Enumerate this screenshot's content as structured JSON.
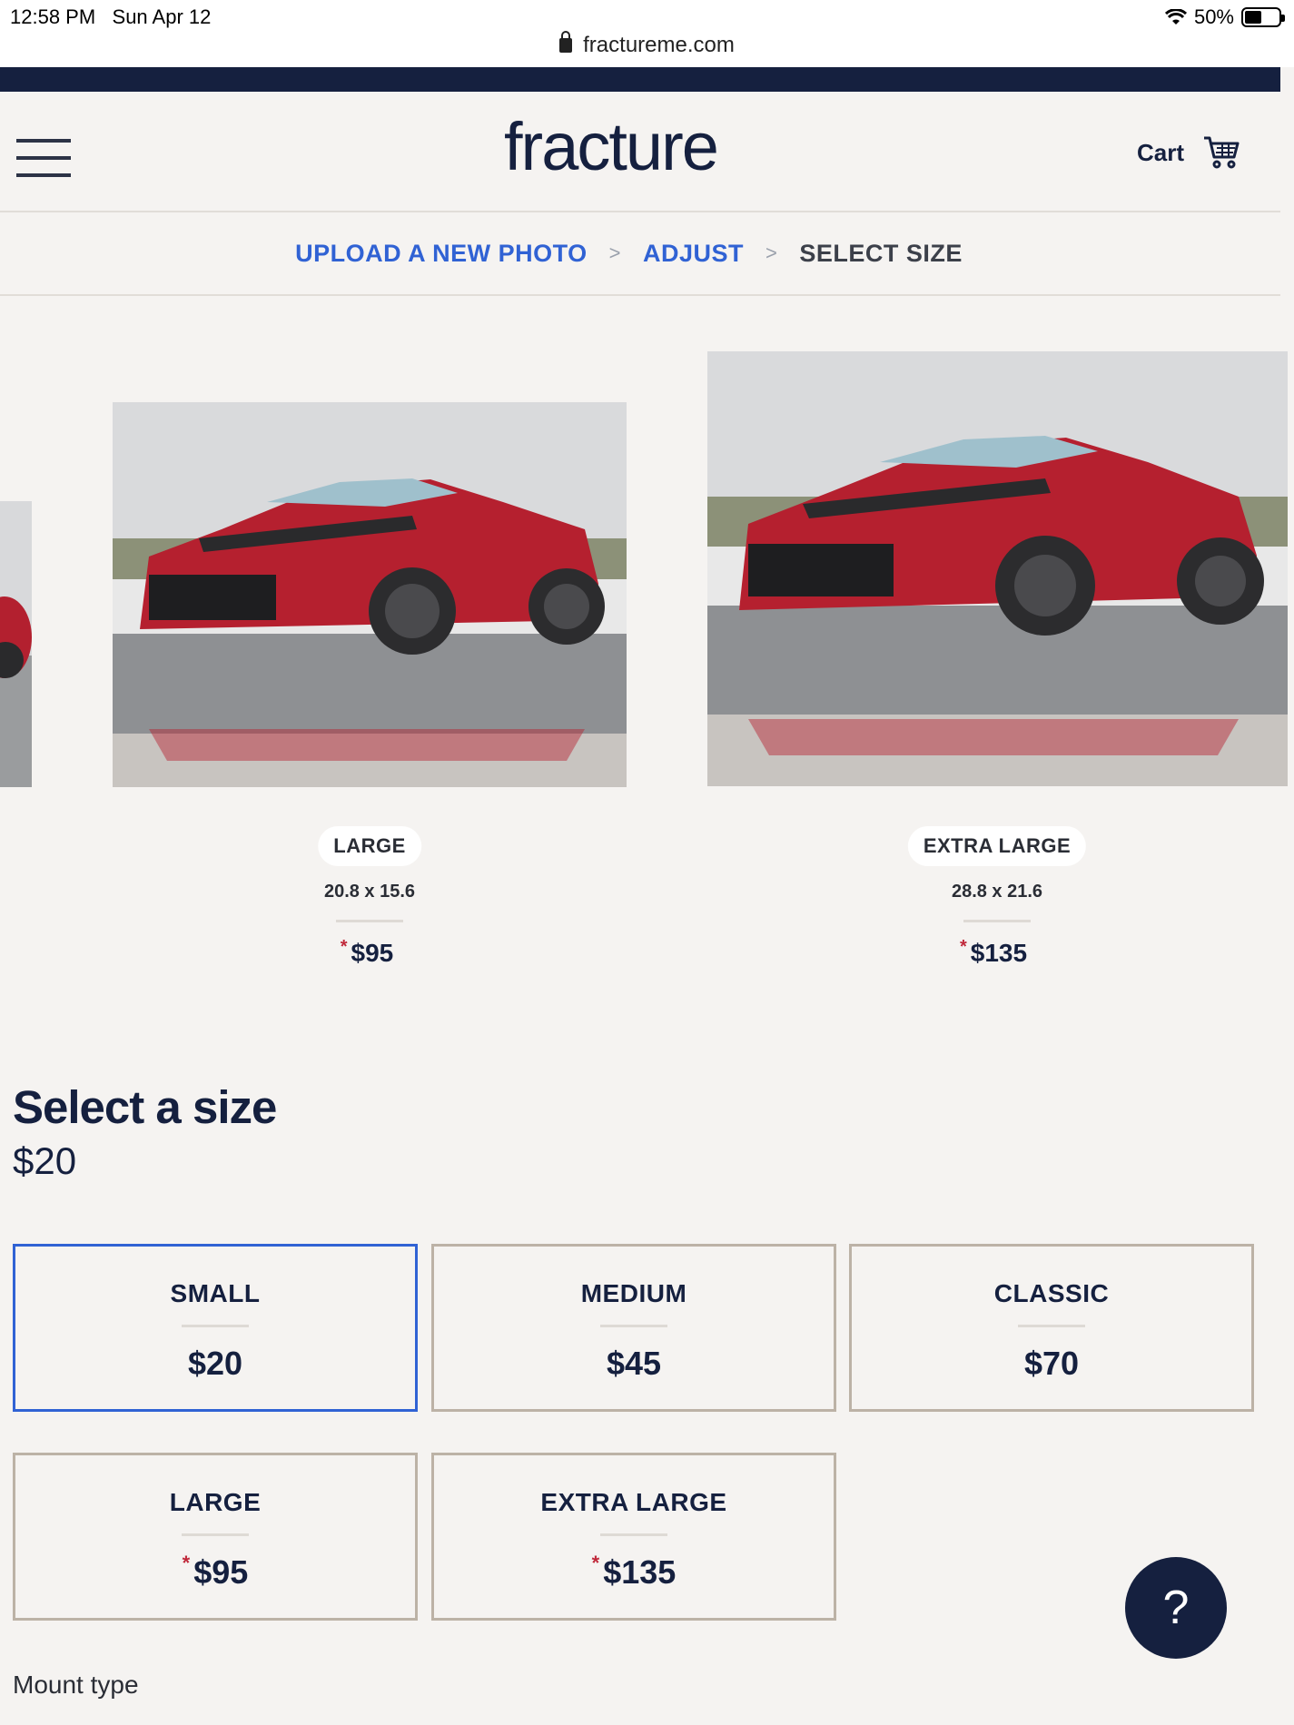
{
  "status_bar": {
    "time": "12:58 PM",
    "date": "Sun Apr 12",
    "battery": "50%",
    "url": "fractureme.com"
  },
  "header": {
    "logo_text": "fracture",
    "cart_label": "Cart"
  },
  "breadcrumb": {
    "step1": "UPLOAD A NEW PHOTO",
    "separator": ">",
    "step2": "ADJUST",
    "step3": "SELECT SIZE"
  },
  "carousel": [
    {
      "name": "LARGE",
      "dimensions": "20.8 x 15.6",
      "price": "$95",
      "asterisk": "*"
    },
    {
      "name": "EXTRA LARGE",
      "dimensions": "28.8 x 21.6",
      "price": "$135",
      "asterisk": "*"
    }
  ],
  "select_size": {
    "title": "Select a size",
    "current_price": "$20",
    "options": [
      {
        "label": "SMALL",
        "price": "$20",
        "selected": true
      },
      {
        "label": "MEDIUM",
        "price": "$45",
        "selected": false
      },
      {
        "label": "CLASSIC",
        "price": "$70",
        "selected": false
      },
      {
        "label": "LARGE",
        "price": "$95",
        "asterisk": "*",
        "selected": false
      },
      {
        "label": "EXTRA LARGE",
        "price": "$135",
        "asterisk": "*",
        "selected": false
      }
    ]
  },
  "mount_type_label": "Mount type",
  "help_button": "?",
  "colors": {
    "navy": "#15203f",
    "link_blue": "#3062d4",
    "asterisk_red": "#c0283a",
    "option_border": "#bcb2a6",
    "background": "#f5f3f1"
  },
  "icons": [
    "hamburger-icon",
    "cart-icon",
    "lock-icon",
    "wifi-icon",
    "battery-icon"
  ]
}
